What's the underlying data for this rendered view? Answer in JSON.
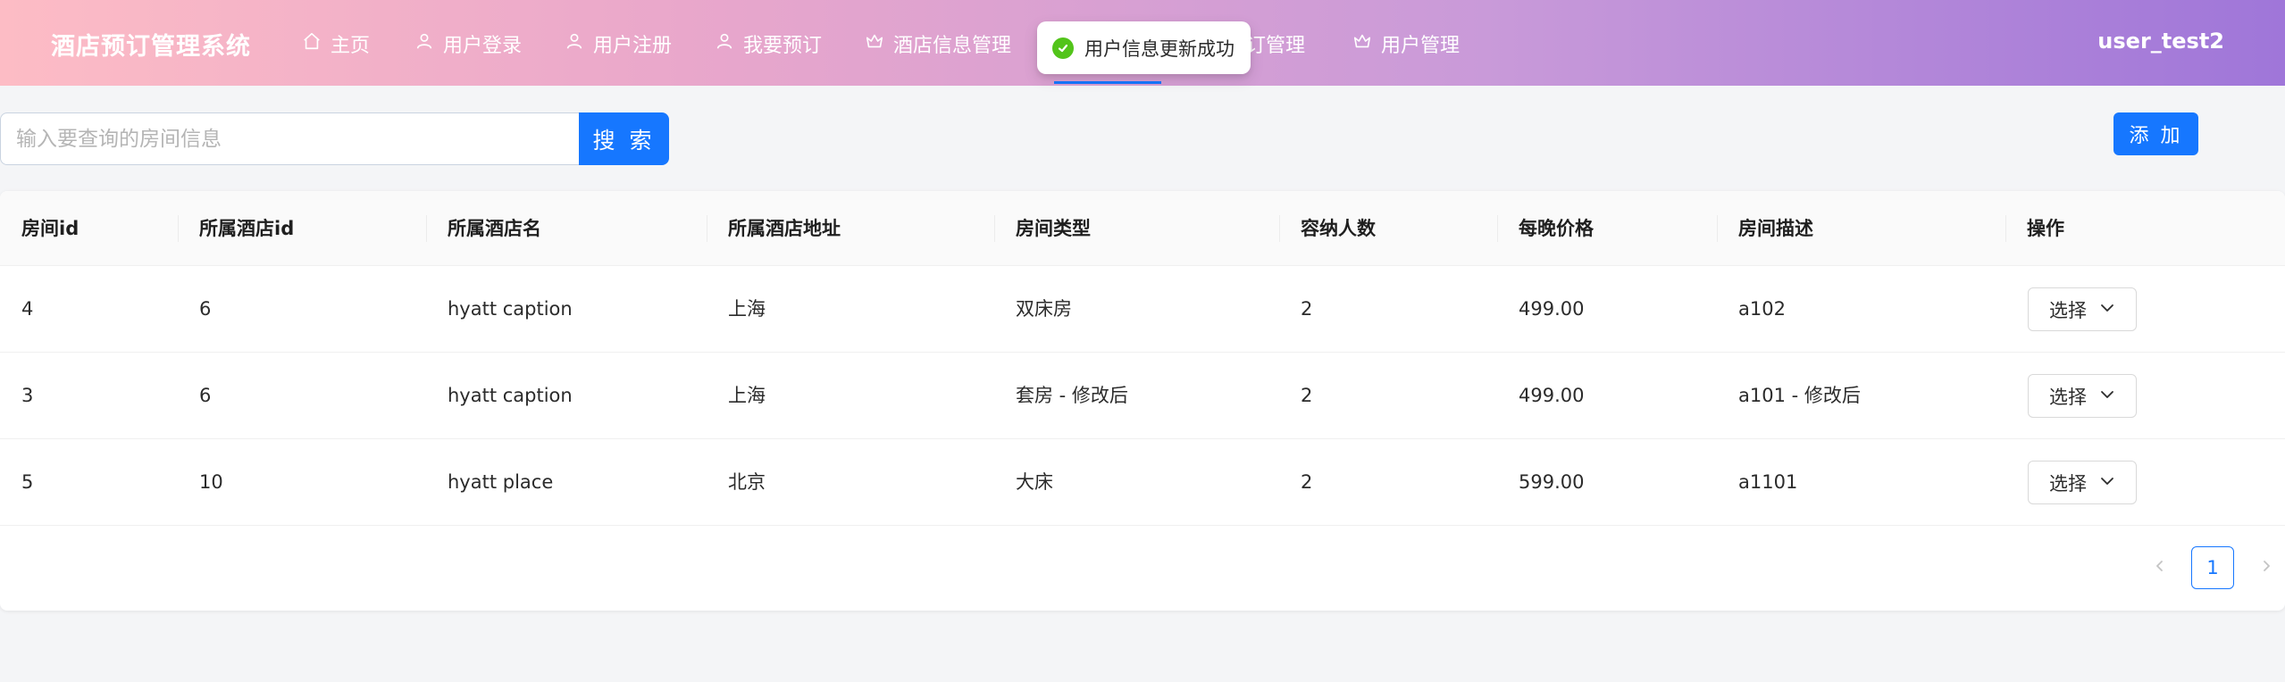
{
  "header": {
    "brand": "酒店预订管理系统",
    "username": "user_test2",
    "nav": [
      {
        "label": "主页",
        "icon": "home-icon"
      },
      {
        "label": "用户登录",
        "icon": "user-icon"
      },
      {
        "label": "用户注册",
        "icon": "user-icon"
      },
      {
        "label": "我要预订",
        "icon": "user-icon"
      },
      {
        "label": "酒店信息管理",
        "icon": "crown-icon"
      },
      {
        "label": "订管理",
        "icon": "crown-icon"
      },
      {
        "label": "用户管理",
        "icon": "crown-icon"
      }
    ]
  },
  "toast": {
    "message": "用户信息更新成功",
    "icon": "check-circle-icon"
  },
  "search": {
    "placeholder": "输入要查询的房间信息",
    "value": "",
    "button_label": "搜 索"
  },
  "add_button_label": "添 加",
  "table": {
    "columns": [
      "房间id",
      "所属酒店id",
      "所属酒店名",
      "所属酒店地址",
      "房间类型",
      "容纳人数",
      "每晚价格",
      "房间描述",
      "操作"
    ],
    "rows": [
      {
        "room_id": "4",
        "hotel_id": "6",
        "hotel_name": "hyatt caption",
        "hotel_address": "上海",
        "room_type": "双床房",
        "capacity": "2",
        "price": "499.00",
        "description": "a102",
        "action": "选择"
      },
      {
        "room_id": "3",
        "hotel_id": "6",
        "hotel_name": "hyatt caption",
        "hotel_address": "上海",
        "room_type": "套房 - 修改后",
        "capacity": "2",
        "price": "499.00",
        "description": "a101 - 修改后",
        "action": "选择"
      },
      {
        "room_id": "5",
        "hotel_id": "10",
        "hotel_name": "hyatt place",
        "hotel_address": "北京",
        "room_type": "大床",
        "capacity": "2",
        "price": "599.00",
        "description": "a1101",
        "action": "选择"
      }
    ]
  },
  "pagination": {
    "current_page": "1"
  },
  "colors": {
    "primary": "#1677ff",
    "success": "#52c41a",
    "header_gradient_start": "#fdbcc5",
    "header_gradient_end": "#9f76d9"
  }
}
